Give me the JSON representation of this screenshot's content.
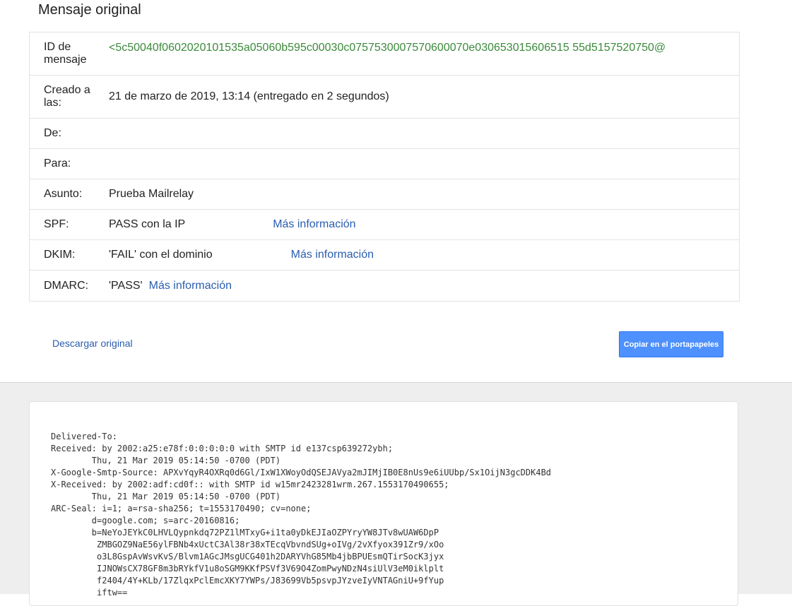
{
  "page": {
    "title": "Mensaje original"
  },
  "info": {
    "message_id": {
      "label": "ID de mensaje",
      "value": "<5c50040f0602020101535a05060b595c00030c0757530007570600070e030653015606515 55d5157520750@"
    },
    "created": {
      "label": "Creado a las:",
      "value": "21 de marzo de 2019, 13:14 (entregado en 2 segundos)"
    },
    "from": {
      "label": "De:"
    },
    "to": {
      "label": "Para:"
    },
    "subject": {
      "label": "Asunto:",
      "value": "Prueba Mailrelay"
    },
    "spf": {
      "label": "SPF:",
      "value": "PASS con la IP",
      "link": "Más información"
    },
    "dkim": {
      "label": "DKIM:",
      "value": "'FAIL' con el dominio",
      "link": "Más información"
    },
    "dmarc": {
      "label": "DMARC:",
      "value": "'PASS'",
      "link": "Más información"
    }
  },
  "actions": {
    "download_label": "Descargar original",
    "copy_label": "Copiar en el portapapeles"
  },
  "raw": {
    "lines": [
      "Delivered-To: ",
      "Received: by 2002:a25:e78f:0:0:0:0:0 with SMTP id e137csp639272ybh;",
      "        Thu, 21 Mar 2019 05:14:50 -0700 (PDT)",
      "X-Google-Smtp-Source: APXvYqyR4OXRq0d6Gl/IxW1XWoyOdQSEJAVya2mJIMjIB0E8nUs9e6iUUbp/Sx1OijN3gcDDK4Bd",
      "X-Received: by 2002:adf:cd0f:: with SMTP id w15mr2423281wrm.267.1553170490655;",
      "        Thu, 21 Mar 2019 05:14:50 -0700 (PDT)",
      "ARC-Seal: i=1; a=rsa-sha256; t=1553170490; cv=none;",
      "        d=google.com; s=arc-20160816;",
      "        b=NeYoJEYkC0LHVLQypnkdq72PZ1lMTxyG+i1ta0yDkEJIaOZPYryYW8JTv8wUAW6DpP",
      "         ZMBGOZ9NaE56ylFBNb4xUctC3Al38r38xTEcqVbvndSUg+oIVg/2vXfyox391Zr9/xOo",
      "         o3L8GspAvWsvKvS/Blvm1AGcJMsgUCG401h2DARYVhG85Mb4jbBPUEsmQTirSocK3jyx",
      "         IJNOWsCX78GF8m3bRYkfV1u8oSGM9KKfPSVf3V69O4ZomPwyNDzN4siUlV3eM0iklplt",
      "         f2404/4Y+KLb/17ZlqxPclEmcXKY7YWPs/J83699Vb5psvpJYzveIyVNTAGniU+9fYup",
      "         iftw=="
    ]
  }
}
